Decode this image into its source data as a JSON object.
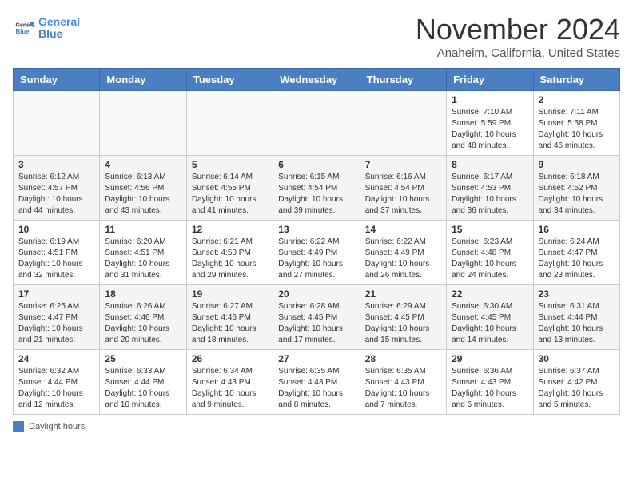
{
  "header": {
    "logo_line1": "General",
    "logo_line2": "Blue",
    "month_title": "November 2024",
    "location": "Anaheim, California, United States"
  },
  "legend": {
    "label": "Daylight hours"
  },
  "days_of_week": [
    "Sunday",
    "Monday",
    "Tuesday",
    "Wednesday",
    "Thursday",
    "Friday",
    "Saturday"
  ],
  "weeks": [
    [
      {
        "day": "",
        "info": ""
      },
      {
        "day": "",
        "info": ""
      },
      {
        "day": "",
        "info": ""
      },
      {
        "day": "",
        "info": ""
      },
      {
        "day": "",
        "info": ""
      },
      {
        "day": "1",
        "info": "Sunrise: 7:10 AM\nSunset: 5:59 PM\nDaylight: 10 hours\nand 48 minutes."
      },
      {
        "day": "2",
        "info": "Sunrise: 7:11 AM\nSunset: 5:58 PM\nDaylight: 10 hours\nand 46 minutes."
      }
    ],
    [
      {
        "day": "3",
        "info": "Sunrise: 6:12 AM\nSunset: 4:57 PM\nDaylight: 10 hours\nand 44 minutes."
      },
      {
        "day": "4",
        "info": "Sunrise: 6:13 AM\nSunset: 4:56 PM\nDaylight: 10 hours\nand 43 minutes."
      },
      {
        "day": "5",
        "info": "Sunrise: 6:14 AM\nSunset: 4:55 PM\nDaylight: 10 hours\nand 41 minutes."
      },
      {
        "day": "6",
        "info": "Sunrise: 6:15 AM\nSunset: 4:54 PM\nDaylight: 10 hours\nand 39 minutes."
      },
      {
        "day": "7",
        "info": "Sunrise: 6:16 AM\nSunset: 4:54 PM\nDaylight: 10 hours\nand 37 minutes."
      },
      {
        "day": "8",
        "info": "Sunrise: 6:17 AM\nSunset: 4:53 PM\nDaylight: 10 hours\nand 36 minutes."
      },
      {
        "day": "9",
        "info": "Sunrise: 6:18 AM\nSunset: 4:52 PM\nDaylight: 10 hours\nand 34 minutes."
      }
    ],
    [
      {
        "day": "10",
        "info": "Sunrise: 6:19 AM\nSunset: 4:51 PM\nDaylight: 10 hours\nand 32 minutes."
      },
      {
        "day": "11",
        "info": "Sunrise: 6:20 AM\nSunset: 4:51 PM\nDaylight: 10 hours\nand 31 minutes."
      },
      {
        "day": "12",
        "info": "Sunrise: 6:21 AM\nSunset: 4:50 PM\nDaylight: 10 hours\nand 29 minutes."
      },
      {
        "day": "13",
        "info": "Sunrise: 6:22 AM\nSunset: 4:49 PM\nDaylight: 10 hours\nand 27 minutes."
      },
      {
        "day": "14",
        "info": "Sunrise: 6:22 AM\nSunset: 4:49 PM\nDaylight: 10 hours\nand 26 minutes."
      },
      {
        "day": "15",
        "info": "Sunrise: 6:23 AM\nSunset: 4:48 PM\nDaylight: 10 hours\nand 24 minutes."
      },
      {
        "day": "16",
        "info": "Sunrise: 6:24 AM\nSunset: 4:47 PM\nDaylight: 10 hours\nand 23 minutes."
      }
    ],
    [
      {
        "day": "17",
        "info": "Sunrise: 6:25 AM\nSunset: 4:47 PM\nDaylight: 10 hours\nand 21 minutes."
      },
      {
        "day": "18",
        "info": "Sunrise: 6:26 AM\nSunset: 4:46 PM\nDaylight: 10 hours\nand 20 minutes."
      },
      {
        "day": "19",
        "info": "Sunrise: 6:27 AM\nSunset: 4:46 PM\nDaylight: 10 hours\nand 18 minutes."
      },
      {
        "day": "20",
        "info": "Sunrise: 6:28 AM\nSunset: 4:45 PM\nDaylight: 10 hours\nand 17 minutes."
      },
      {
        "day": "21",
        "info": "Sunrise: 6:29 AM\nSunset: 4:45 PM\nDaylight: 10 hours\nand 15 minutes."
      },
      {
        "day": "22",
        "info": "Sunrise: 6:30 AM\nSunset: 4:45 PM\nDaylight: 10 hours\nand 14 minutes."
      },
      {
        "day": "23",
        "info": "Sunrise: 6:31 AM\nSunset: 4:44 PM\nDaylight: 10 hours\nand 13 minutes."
      }
    ],
    [
      {
        "day": "24",
        "info": "Sunrise: 6:32 AM\nSunset: 4:44 PM\nDaylight: 10 hours\nand 12 minutes."
      },
      {
        "day": "25",
        "info": "Sunrise: 6:33 AM\nSunset: 4:44 PM\nDaylight: 10 hours\nand 10 minutes."
      },
      {
        "day": "26",
        "info": "Sunrise: 6:34 AM\nSunset: 4:43 PM\nDaylight: 10 hours\nand 9 minutes."
      },
      {
        "day": "27",
        "info": "Sunrise: 6:35 AM\nSunset: 4:43 PM\nDaylight: 10 hours\nand 8 minutes."
      },
      {
        "day": "28",
        "info": "Sunrise: 6:35 AM\nSunset: 4:43 PM\nDaylight: 10 hours\nand 7 minutes."
      },
      {
        "day": "29",
        "info": "Sunrise: 6:36 AM\nSunset: 4:43 PM\nDaylight: 10 hours\nand 6 minutes."
      },
      {
        "day": "30",
        "info": "Sunrise: 6:37 AM\nSunset: 4:42 PM\nDaylight: 10 hours\nand 5 minutes."
      }
    ]
  ]
}
